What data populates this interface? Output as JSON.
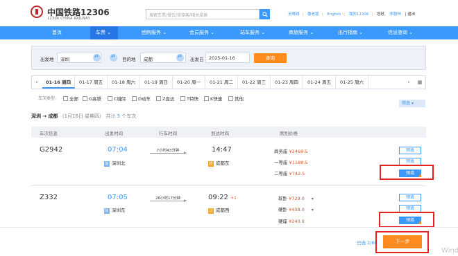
{
  "header": {
    "logo_title": "中国铁路12306",
    "logo_subtitle": "12306 CHINA RAILWAY",
    "search_placeholder": "搜索车票/餐饮/常旅客/相关规章",
    "links": [
      "无障碍",
      "敬老版",
      "English",
      "我的12306",
      "您好,",
      "李聪林",
      "| 退出"
    ]
  },
  "nav": [
    "首页",
    "车票",
    "团购服务",
    "会员服务",
    "站车服务",
    "商旅服务",
    "出行指南",
    "信息查询"
  ],
  "form": {
    "from_label": "出发地",
    "from_value": "深圳",
    "to_label": "目的地",
    "to_value": "成都",
    "date_label": "出发日",
    "date_value": "2025-01-16",
    "query_label": "查询"
  },
  "dates": [
    "01-16 周四",
    "01-17 周五",
    "01-18 周六",
    "01-19 周日",
    "01-20 周一",
    "01-21 周二",
    "01-22 周三",
    "01-23 周四",
    "01-24 周五",
    "01-25 周六"
  ],
  "filter": {
    "label": "车次类型:",
    "options": [
      "全部",
      "G高铁",
      "C城际",
      "D动车",
      "Z直达",
      "T特快",
      "K快速",
      "其他"
    ],
    "button": "筛选"
  },
  "summary": {
    "from": "深圳",
    "arrow": "→",
    "to": "成都",
    "date": "（1月16日 星期四）",
    "count_prefix": "共计",
    "count": "5",
    "count_suffix": "个车次"
  },
  "table_headers": [
    "车次信息",
    "出发时间",
    "行车时间",
    "到达时间",
    "席别价格"
  ],
  "trains": [
    {
      "number": "G2942",
      "depart": "07:04",
      "duration": "7小时43分钟",
      "arrive": "14:47",
      "next_day": "",
      "from_badge": "始",
      "from_station": "深圳北",
      "to_badge": "终",
      "to_station": "成都东",
      "seats": [
        {
          "name": "商务座",
          "price": "¥2469.5"
        },
        {
          "name": "一等座",
          "price": "¥1188.5"
        },
        {
          "name": "二等座",
          "price": "¥742.5"
        }
      ],
      "book_label": "预填"
    },
    {
      "number": "Z332",
      "depart": "07:05",
      "duration": "26小时17分钟",
      "arrive": "09:22",
      "next_day": "+1",
      "from_badge": "始",
      "from_station": "深圳东",
      "to_badge": "过",
      "to_station": "成都西",
      "seats": [
        {
          "name": "软卧",
          "price": "¥729.0"
        },
        {
          "name": "硬卧",
          "price": "¥408.0"
        },
        {
          "name": "硬座",
          "price": "¥240.0"
        }
      ],
      "book_label": "预填"
    }
  ],
  "footer": {
    "selected_text": "已选 2/60",
    "next_label": "下一步",
    "watermark": "Wind"
  },
  "colors": {
    "primary": "#3b99fc",
    "accent": "#ff8a1d",
    "price": "#e8541e",
    "highlight": "#e5201e"
  }
}
